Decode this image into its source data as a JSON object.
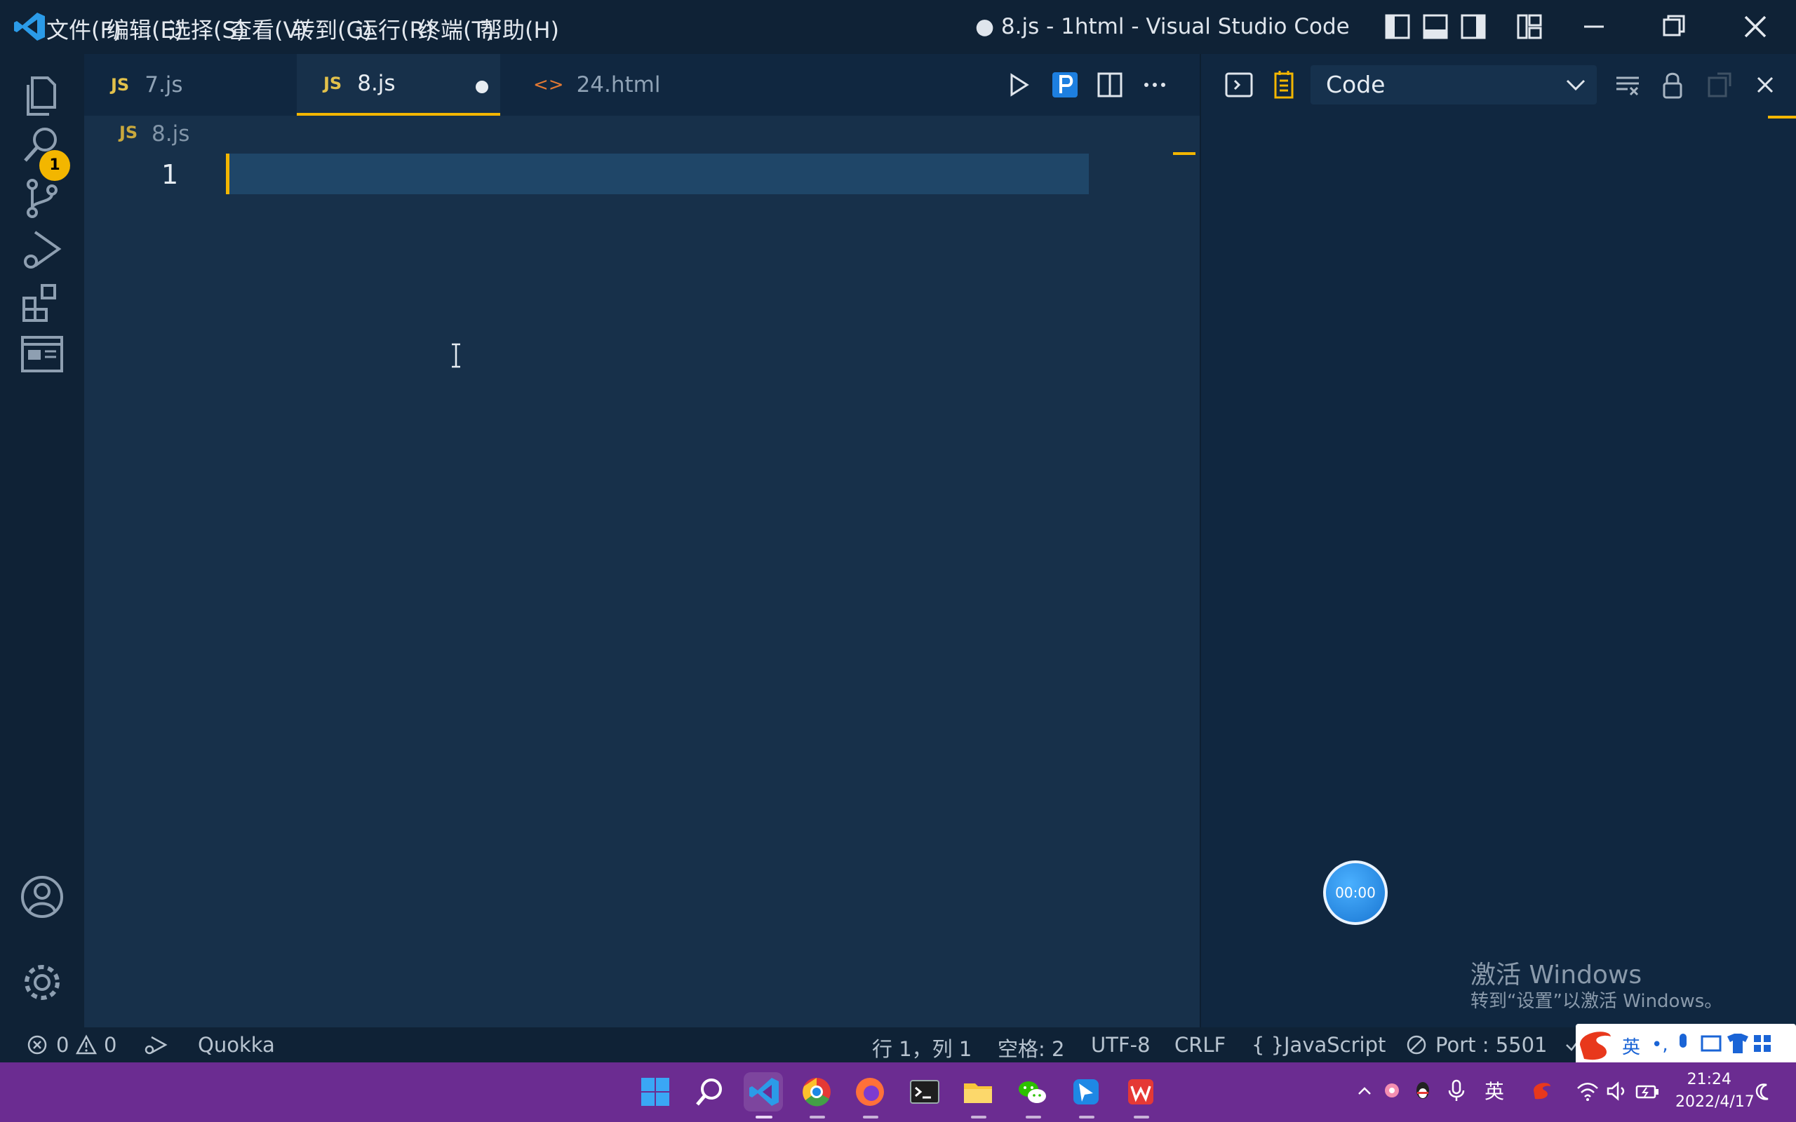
{
  "titlebar": {
    "menus": [
      "文件(F)",
      "编辑(E)",
      "选择(S)",
      "查看(V)",
      "转到(G)",
      "运行(R)",
      "终端(T)",
      "帮助(H)"
    ],
    "window_title": "● 8.js - 1html - Visual Studio Code"
  },
  "activitybar": {
    "explorer_badge": "1"
  },
  "tabs": [
    {
      "label": "7.js",
      "badge": "JS"
    },
    {
      "label": "8.js",
      "badge": "JS"
    },
    {
      "label": "24.html",
      "badge": "<>"
    }
  ],
  "breadcrumb": {
    "badge": "JS",
    "file": "8.js"
  },
  "editor": {
    "line_number": "1"
  },
  "rightpanel": {
    "select_value": "Code",
    "timer": "00:00",
    "activate_title": "激活 Windows",
    "activate_sub": "转到“设置”以激活 Windows。"
  },
  "statusbar": {
    "errors": "0",
    "warnings": "0",
    "quokka": "Quokka",
    "position": "行 1，列 1",
    "spaces": "空格: 2",
    "encoding": "UTF-8",
    "eol": "CRLF",
    "language": "JavaScript",
    "port": "Port : 5501"
  },
  "taskbar": {
    "lang": "英",
    "time": "21:24",
    "date": "2022/4/17"
  },
  "colors": {
    "accent": "#f3b600",
    "editor_bg": "#17304a",
    "taskbar": "#6b2c91"
  }
}
